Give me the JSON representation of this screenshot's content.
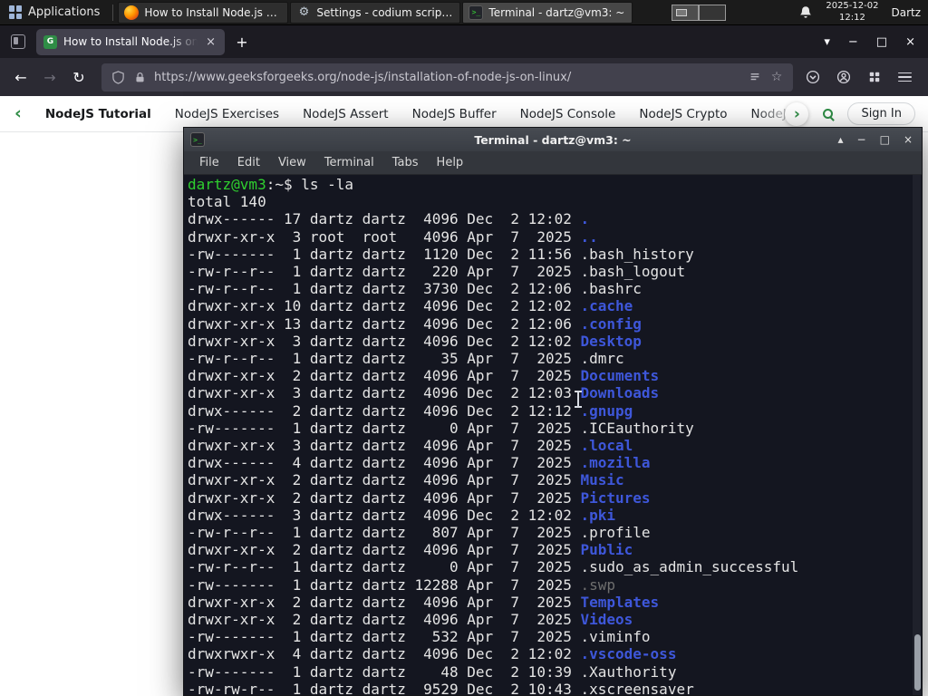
{
  "panel": {
    "applications_label": "Applications",
    "tasks": [
      {
        "label": "How to Install Node.js o...",
        "icon": "firefox",
        "active": false
      },
      {
        "label": "Settings - codium script...",
        "icon": "settings",
        "active": false
      },
      {
        "label": "Terminal - dartz@vm3: ~",
        "icon": "terminal",
        "active": true
      }
    ],
    "clock_date": "2025-12-02",
    "clock_time": "12:12",
    "user_label": "Dartz"
  },
  "browser": {
    "tab_title": "How to Install Node.js on...",
    "url": "https://www.geeksforgeeks.org/node-js/installation-of-node-js-on-linux/",
    "site_nav_items": [
      "NodeJS Tutorial",
      "NodeJS Exercises",
      "NodeJS Assert",
      "NodeJS Buffer",
      "NodeJS Console",
      "NodeJS Crypto",
      "NodeJS DNS",
      "Node"
    ],
    "sign_in_label": "Sign In"
  },
  "icons": {
    "back": "←",
    "forward": "→",
    "reload": "↻",
    "new_tab": "+",
    "list_tabs": "▾",
    "minimize": "−",
    "maximize": "□",
    "close": "×",
    "shade": "▴",
    "nav_prev": "‹",
    "nav_next": "›",
    "star": "☆",
    "gear": "⚙",
    "terminal_glyph": ">_"
  },
  "terminal": {
    "window_title": "Terminal - dartz@vm3: ~",
    "menu_items": [
      "File",
      "Edit",
      "View",
      "Terminal",
      "Tabs",
      "Help"
    ],
    "prompt_user_host": "dartz@vm3",
    "prompt_rest": ":~$ ",
    "command": "ls -la",
    "total_line": "total 140",
    "listing": [
      {
        "meta": "drwx------ 17 dartz dartz  4096 Dec  2 12:02",
        "name": ".",
        "type": "dir"
      },
      {
        "meta": "drwxr-xr-x  3 root  root   4096 Apr  7  2025",
        "name": "..",
        "type": "dir"
      },
      {
        "meta": "-rw-------  1 dartz dartz  1120 Dec  2 11:56",
        "name": ".bash_history",
        "type": "file"
      },
      {
        "meta": "-rw-r--r--  1 dartz dartz   220 Apr  7  2025",
        "name": ".bash_logout",
        "type": "file"
      },
      {
        "meta": "-rw-r--r--  1 dartz dartz  3730 Dec  2 12:06",
        "name": ".bashrc",
        "type": "file"
      },
      {
        "meta": "drwxr-xr-x 10 dartz dartz  4096 Dec  2 12:02",
        "name": ".cache",
        "type": "dir"
      },
      {
        "meta": "drwxr-xr-x 13 dartz dartz  4096 Dec  2 12:06",
        "name": ".config",
        "type": "dir"
      },
      {
        "meta": "drwxr-xr-x  3 dartz dartz  4096 Dec  2 12:02",
        "name": "Desktop",
        "type": "dir"
      },
      {
        "meta": "-rw-r--r--  1 dartz dartz    35 Apr  7  2025",
        "name": ".dmrc",
        "type": "file"
      },
      {
        "meta": "drwxr-xr-x  2 dartz dartz  4096 Apr  7  2025",
        "name": "Documents",
        "type": "dir"
      },
      {
        "meta": "drwxr-xr-x  3 dartz dartz  4096 Dec  2 12:03",
        "name": "Downloads",
        "type": "dir"
      },
      {
        "meta": "drwx------  2 dartz dartz  4096 Dec  2 12:12",
        "name": ".gnupg",
        "type": "dir"
      },
      {
        "meta": "-rw-------  1 dartz dartz     0 Apr  7  2025",
        "name": ".ICEauthority",
        "type": "file"
      },
      {
        "meta": "drwxr-xr-x  3 dartz dartz  4096 Apr  7  2025",
        "name": ".local",
        "type": "dir"
      },
      {
        "meta": "drwx------  4 dartz dartz  4096 Apr  7  2025",
        "name": ".mozilla",
        "type": "dir"
      },
      {
        "meta": "drwxr-xr-x  2 dartz dartz  4096 Apr  7  2025",
        "name": "Music",
        "type": "dir"
      },
      {
        "meta": "drwxr-xr-x  2 dartz dartz  4096 Apr  7  2025",
        "name": "Pictures",
        "type": "dir"
      },
      {
        "meta": "drwx------  3 dartz dartz  4096 Dec  2 12:02",
        "name": ".pki",
        "type": "dir"
      },
      {
        "meta": "-rw-r--r--  1 dartz dartz   807 Apr  7  2025",
        "name": ".profile",
        "type": "file"
      },
      {
        "meta": "drwxr-xr-x  2 dartz dartz  4096 Apr  7  2025",
        "name": "Public",
        "type": "dir"
      },
      {
        "meta": "-rw-r--r--  1 dartz dartz     0 Apr  7  2025",
        "name": ".sudo_as_admin_successful",
        "type": "file"
      },
      {
        "meta": "-rw-------  1 dartz dartz 12288 Apr  7  2025",
        "name": ".swp",
        "type": "dim"
      },
      {
        "meta": "drwxr-xr-x  2 dartz dartz  4096 Apr  7  2025",
        "name": "Templates",
        "type": "dir"
      },
      {
        "meta": "drwxr-xr-x  2 dartz dartz  4096 Apr  7  2025",
        "name": "Videos",
        "type": "dir"
      },
      {
        "meta": "-rw-------  1 dartz dartz   532 Apr  7  2025",
        "name": ".viminfo",
        "type": "file"
      },
      {
        "meta": "drwxrwxr-x  4 dartz dartz  4096 Dec  2 12:02",
        "name": ".vscode-oss",
        "type": "dir"
      },
      {
        "meta": "-rw-------  1 dartz dartz    48 Dec  2 10:39",
        "name": ".Xauthority",
        "type": "file"
      },
      {
        "meta": "-rw-rw-r--  1 dartz dartz  9529 Dec  2 10:43",
        "name": ".xscreensaver",
        "type": "file"
      }
    ]
  },
  "colors": {
    "accent_green": "#2f8d46",
    "terminal_dir_blue": "#3e57da",
    "terminal_prompt_green": "#2fd02f",
    "terminal_bg": "#141620"
  }
}
